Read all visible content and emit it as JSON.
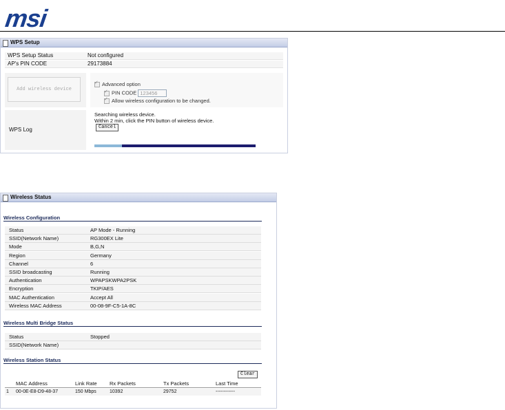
{
  "brand": {
    "logo_text": "msi"
  },
  "wps": {
    "title": "WPS Setup",
    "status_label": "WPS Setup Status",
    "status_value": "Not configured",
    "pin_label": "AP's PIN CODE",
    "pin_value": "29173884",
    "add_device_button": "Add wireless device",
    "advanced_option": "Advanced option",
    "pin_code_label": "PIN CODE",
    "pin_code_value": "123456",
    "allow_config": "Allow wireless configuration to be changed.",
    "log_label": "WPS Log",
    "log_line1": "Searching wireless device.",
    "log_line2": "Within 2 min, click the PIN button of wireless device.",
    "cancel_button": "Cancel",
    "progress": 0.17
  },
  "wireless_status": {
    "title": "Wireless Status",
    "config_heading": "Wireless Configuration",
    "config_rows": [
      {
        "k": "Status",
        "v": "AP Mode - Running"
      },
      {
        "k": "SSID(Network Name)",
        "v": "RG300EX Lite"
      },
      {
        "k": "Mode",
        "v": "B,G,N"
      },
      {
        "k": "Region",
        "v": "Germany"
      },
      {
        "k": "Channel",
        "v": "6"
      },
      {
        "k": "SSID broadcasting",
        "v": "Running"
      },
      {
        "k": "Authentication",
        "v": "WPAPSKWPA2PSK"
      },
      {
        "k": "Encryption",
        "v": "TKIP/AES"
      },
      {
        "k": "MAC Authentication",
        "v": "Accept All"
      },
      {
        "k": "Wireless MAC Address",
        "v": "00-08-9F-C5-1A-8C"
      }
    ],
    "bridge_heading": "Wireless Multi Bridge Status",
    "bridge_rows": [
      {
        "k": "Status",
        "v": "Stopped"
      },
      {
        "k": "SSID(Network Name)",
        "v": ""
      }
    ],
    "station_heading": "Wireless Station Status",
    "clear_button": "Clear",
    "station_columns": [
      "MAC Address",
      "Link Rate",
      "Rx Packets",
      "Tx Packets",
      "Last Time"
    ],
    "station_rows": [
      {
        "idx": "1",
        "mac": "00-0E-E8-D9-48-37",
        "rate": "150 Mbps",
        "rx": "10392",
        "tx": "29752",
        "last": "------------"
      }
    ]
  }
}
